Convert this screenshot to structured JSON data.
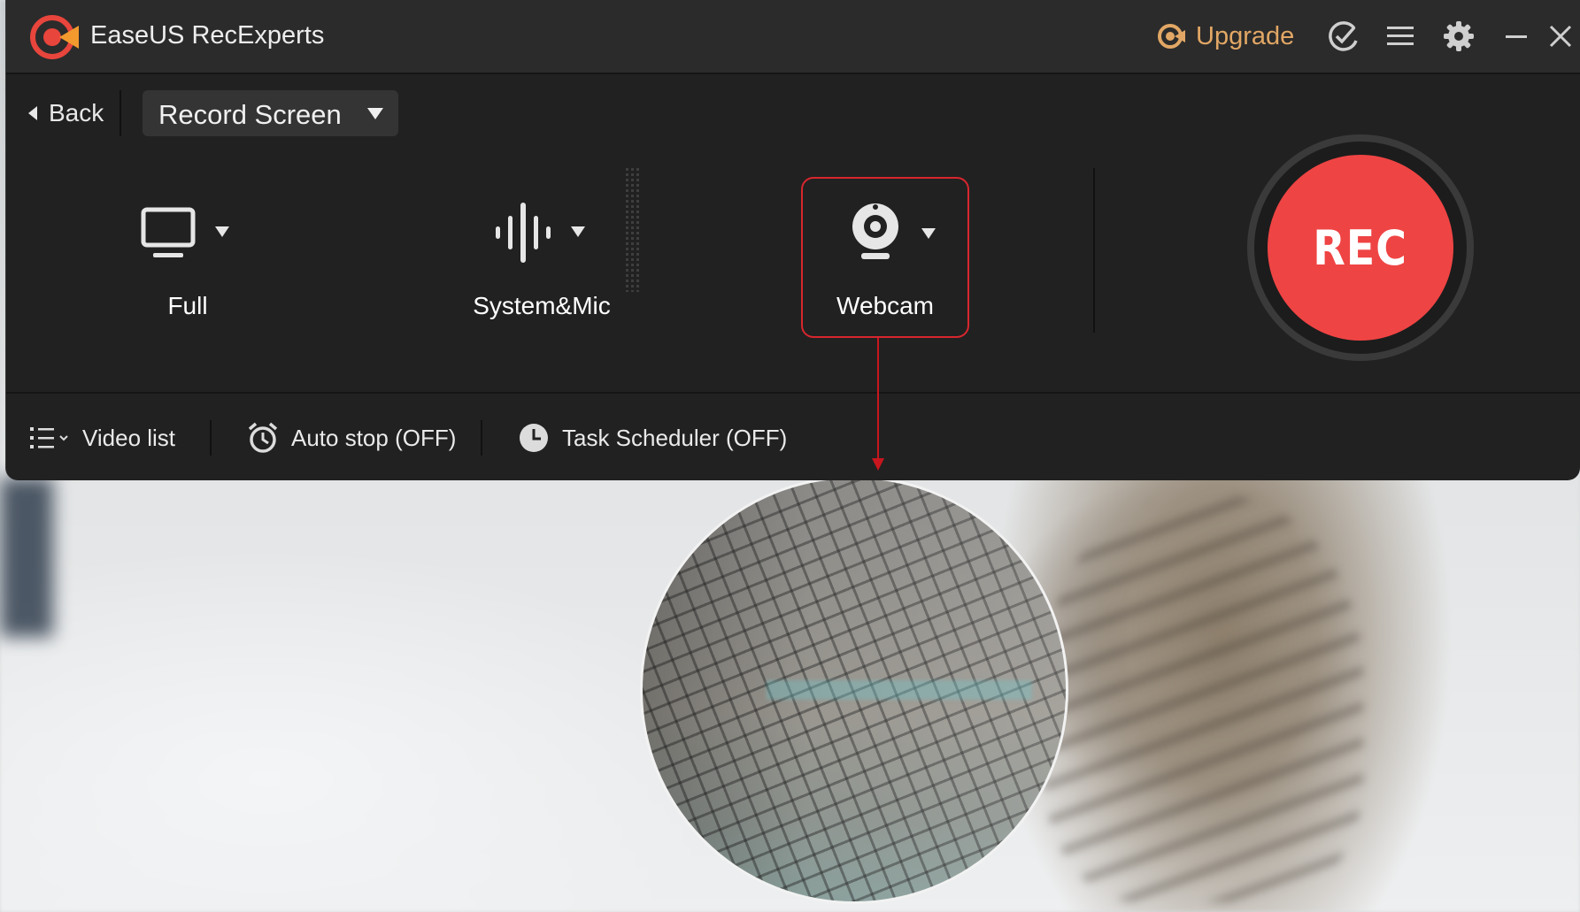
{
  "app": {
    "title": "EaseUS RecExperts",
    "brand_color": "#e8453c"
  },
  "titlebar": {
    "upgrade_label": "Upgrade",
    "upgrade_color": "#e2a765",
    "icons": [
      "upgrade-crown-icon",
      "check-badge-icon",
      "menu-icon",
      "settings-gear-icon",
      "minimize-icon",
      "close-icon"
    ]
  },
  "toolbar": {
    "back_label": "Back",
    "mode_select": {
      "value": "Record Screen"
    }
  },
  "sources": [
    {
      "label": "Full",
      "icon": "monitor-icon"
    },
    {
      "label": "System&Mic",
      "icon": "audio-waveform-icon"
    },
    {
      "label": "Webcam",
      "icon": "webcam-icon",
      "highlight_color": "#d8262e"
    }
  ],
  "rec_button": {
    "label": "REC",
    "color": "#ef4444"
  },
  "bottom_bar": {
    "video_list_label": "Video list",
    "auto_stop_label": "Auto stop (OFF)",
    "task_scheduler_label": "Task Scheduler (OFF)"
  }
}
